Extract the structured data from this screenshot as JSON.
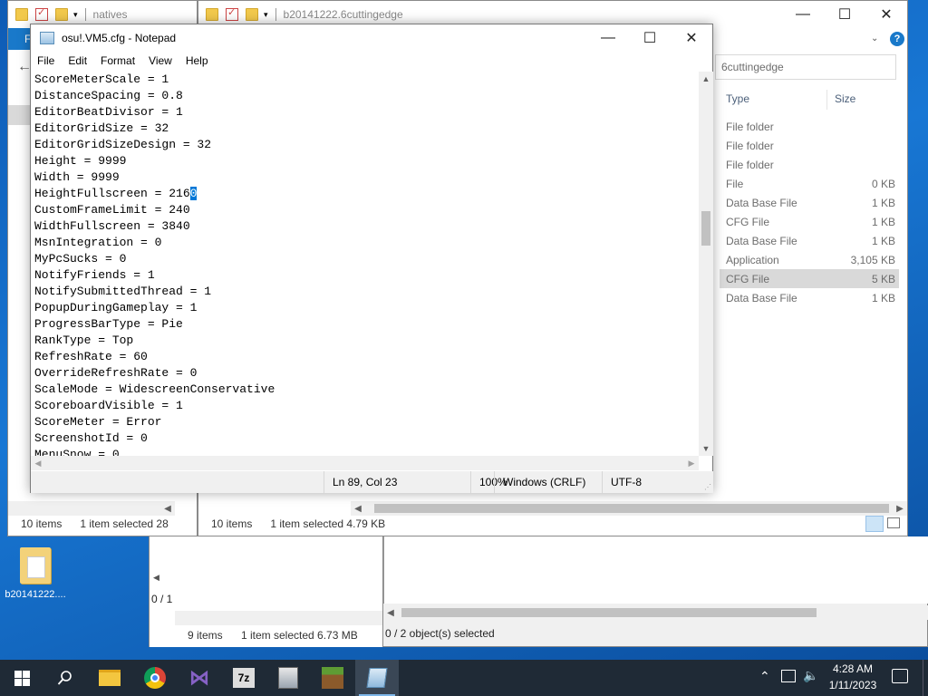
{
  "desktop": {
    "icon_label": "b20141222...."
  },
  "explorer_left": {
    "path_text": "natives",
    "ribbon_tab": "F",
    "status_items": "10 items",
    "status_selected": "1 item selected  28"
  },
  "explorer_right": {
    "path_text": "b20141222.6cuttingedge",
    "search_text": "6cuttingedge",
    "col_type": "Type",
    "col_size": "Size",
    "rows": [
      {
        "type": "File folder",
        "size": ""
      },
      {
        "type": "File folder",
        "size": ""
      },
      {
        "type": "File folder",
        "size": ""
      },
      {
        "type": "File",
        "size": "0 KB"
      },
      {
        "type": "Data Base File",
        "size": "1 KB"
      },
      {
        "type": "CFG File",
        "size": "1 KB"
      },
      {
        "type": "Data Base File",
        "size": "1 KB"
      },
      {
        "type": "Application",
        "size": "3,105 KB"
      },
      {
        "type": "CFG File",
        "size": "5 KB"
      },
      {
        "type": "Data Base File",
        "size": "1 KB"
      }
    ],
    "status_items": "10 items",
    "status_selected": "1 item selected  4.79 KB"
  },
  "explorer_bottom_left": {
    "status_fragment": "0 / 1",
    "status_items": "9 items",
    "status_selected": "1 item selected  6.73 MB"
  },
  "sevenzip": {
    "status": "0 / 2 object(s) selected"
  },
  "notepad": {
    "title": "osu!.VM5.cfg - Notepad",
    "menu": [
      "File",
      "Edit",
      "Format",
      "View",
      "Help"
    ],
    "lines": [
      "ScoreMeterScale = 1",
      "DistanceSpacing = 0.8",
      "EditorBeatDivisor = 1",
      "EditorGridSize = 32",
      "EditorGridSizeDesign = 32",
      "Height = 9999",
      "Width = 9999",
      "HeightFullscreen = 2160",
      "CustomFrameLimit = 240",
      "WidthFullscreen = 3840",
      "MsnIntegration = 0",
      "MyPcSucks = 0",
      "NotifyFriends = 1",
      "NotifySubmittedThread = 1",
      "PopupDuringGameplay = 1",
      "ProgressBarType = Pie",
      "RankType = Top",
      "RefreshRate = 60",
      "OverrideRefreshRate = 0",
      "ScaleMode = WidescreenConservative",
      "ScoreboardVisible = 1",
      "ScoreMeter = Error",
      "ScreenshotId = 0",
      "MenuSnow = 0"
    ],
    "highlight_line_prefix": "HeightFullscreen = 216",
    "highlight_text": "0",
    "status_position": "Ln 89, Col 23",
    "status_zoom": "100%",
    "status_eol": "Windows (CRLF)",
    "status_encoding": "UTF-8"
  },
  "taskbar": {
    "apps": [
      "start-button",
      "search-button",
      "file-explorer",
      "chrome",
      "visual-studio",
      "7zip",
      "app-installer",
      "minecraft",
      "notepad"
    ],
    "time": "4:28 AM",
    "date": "1/11/2023"
  }
}
